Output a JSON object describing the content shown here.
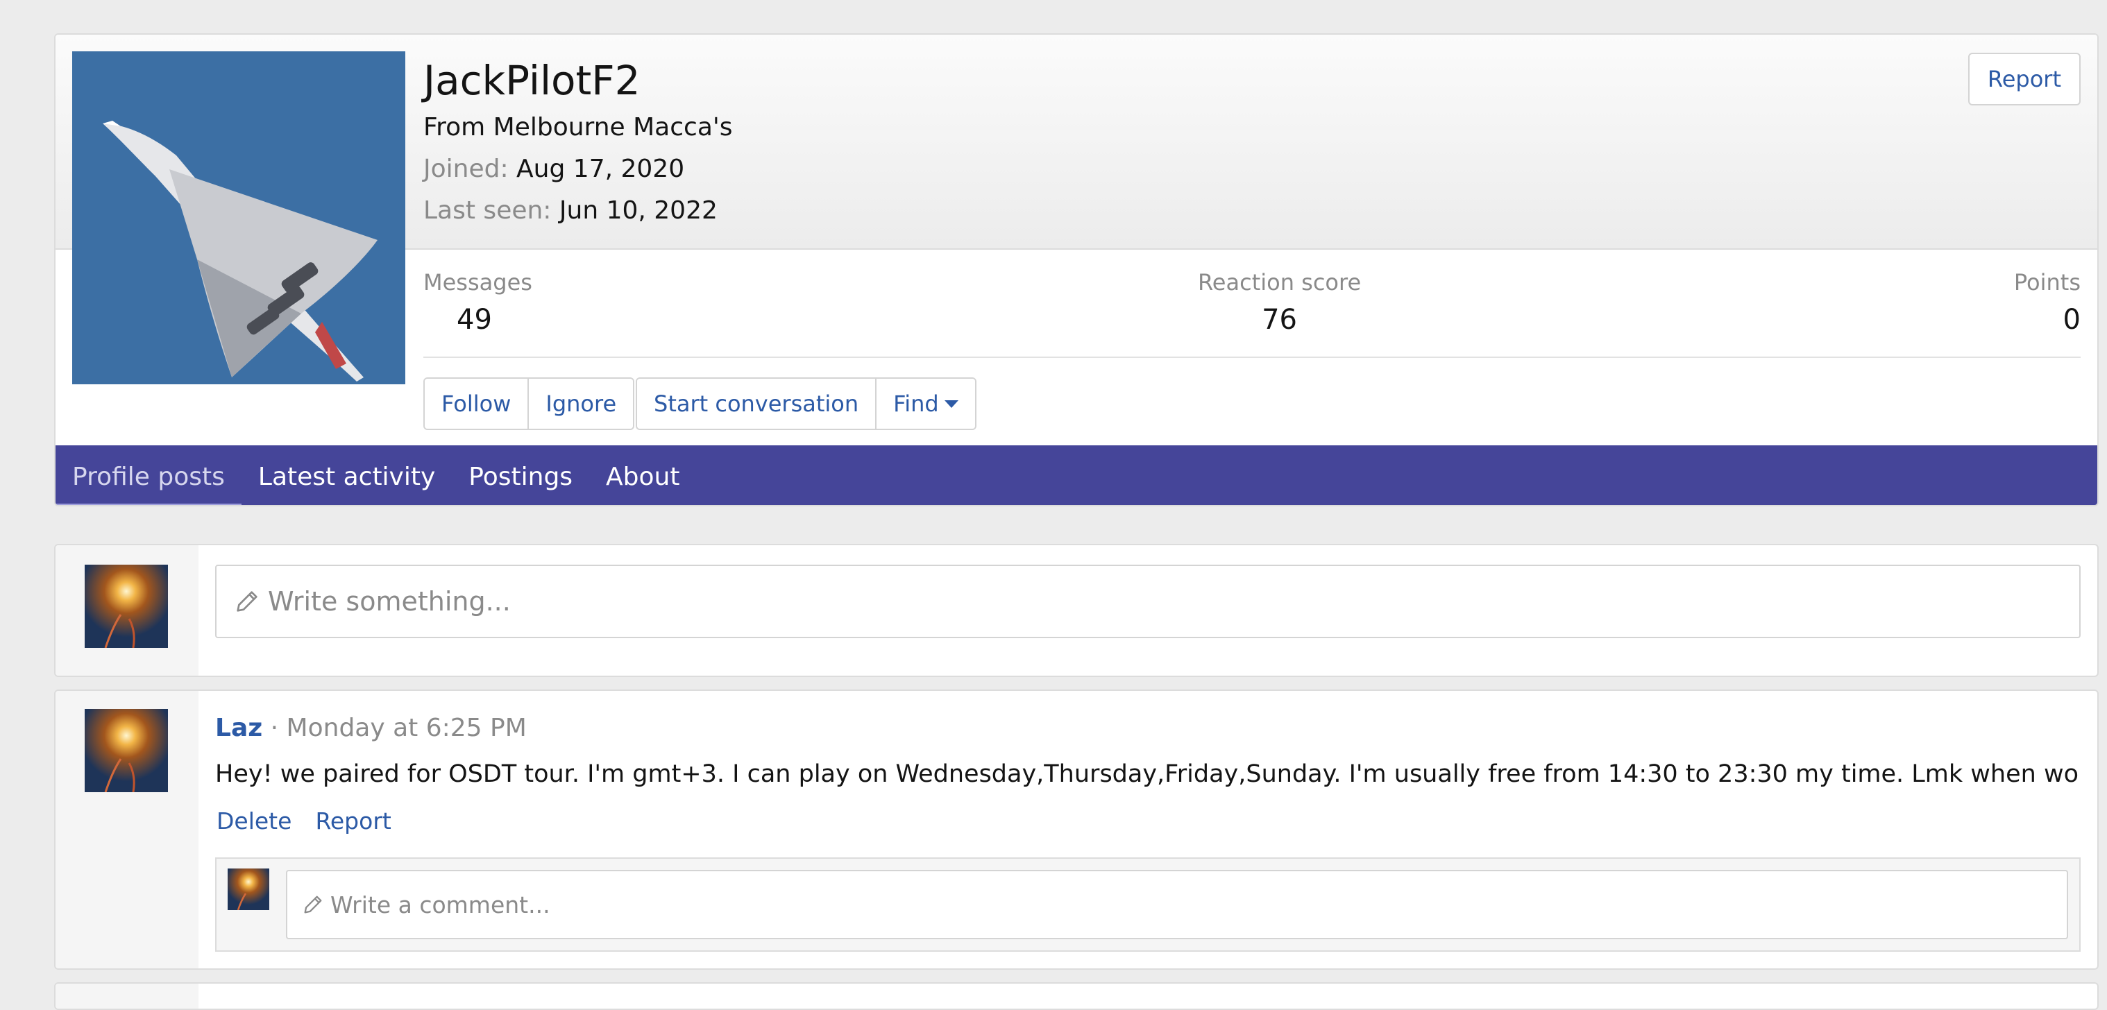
{
  "profile": {
    "username": "JackPilotF2",
    "from_text": "From Melbourne Macca's",
    "joined_label": "Joined:",
    "joined_value": "Aug 17, 2020",
    "last_seen_label": "Last seen:",
    "last_seen_value": "Jun 10, 2022",
    "report_label": "Report",
    "avatar_icon": "concorde-airplane-photo"
  },
  "stats": {
    "messages_label": "Messages",
    "messages_value": "49",
    "reaction_label": "Reaction score",
    "reaction_value": "76",
    "points_label": "Points",
    "points_value": "0"
  },
  "actions": {
    "follow": "Follow",
    "ignore": "Ignore",
    "start_conversation": "Start conversation",
    "find": "Find"
  },
  "tabs": [
    {
      "label": "Profile posts",
      "active": true
    },
    {
      "label": "Latest activity",
      "active": false
    },
    {
      "label": "Postings",
      "active": false
    },
    {
      "label": "About",
      "active": false
    }
  ],
  "composer": {
    "placeholder": "Write something..."
  },
  "post": {
    "author": "Laz",
    "separator": "·",
    "time": "Monday at 6:25 PM",
    "body": "Hey! we paired for OSDT tour. I'm gmt+3. I can play on Wednesday,Thursday,Friday,Sunday. I'm usually free from 14:30 to 23:30 my time. Lmk when works best",
    "delete_label": "Delete",
    "report_label": "Report",
    "comment_placeholder": "Write a comment..."
  },
  "colors": {
    "accent_link": "#2c5aa6",
    "tab_bar": "#454599",
    "page_background": "#ececec"
  }
}
